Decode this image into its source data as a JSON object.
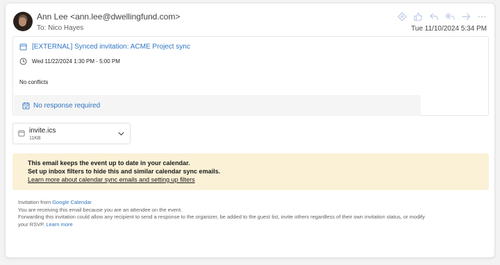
{
  "email": {
    "sender_name": "Ann Lee",
    "sender_address": "<ann.lee@dwellingfund.com>",
    "to_label": "To:",
    "to_name": "Nico Hayes",
    "date": "Tue 11/10/2024 5:34 PM"
  },
  "actions": [
    {
      "name": "tag-icon"
    },
    {
      "name": "like-icon"
    },
    {
      "name": "reply-icon"
    },
    {
      "name": "reply-all-icon"
    },
    {
      "name": "forward-icon"
    },
    {
      "name": "more-icon"
    }
  ],
  "invite": {
    "title": "[EXTERNAL] Synced invitation: ACME Project sync",
    "time": "Wed 11/22/2024 1:30 PM - 5:00 PM",
    "conflicts": "No conflicts",
    "response": "No response required"
  },
  "attachment": {
    "name": "invite.ics",
    "size": "11KB"
  },
  "banner": {
    "line1": "This email keeps the event up to date in your calendar.",
    "line2": "Set up inbox filters to hide this and similar calendar sync emails.",
    "link": "Learn more about calendar sync emails and setting up filters"
  },
  "footer": {
    "invitation_from": "Invitation from",
    "google_calendar": "Google Calendar",
    "line2": "You are receiving this email because you are an attendee on the event.",
    "line3": "Forwarding this invitation could allow any recipient to send a response to the organizer, be added to the guest list, invite others regardless of their own invitation status, or modify",
    "line4": "your RSVP.",
    "learn_more": "Learn more"
  },
  "colors": {
    "link": "#2f74c0",
    "banner_bg": "#fbf1d7",
    "action_icon": "#b9c7e4"
  }
}
